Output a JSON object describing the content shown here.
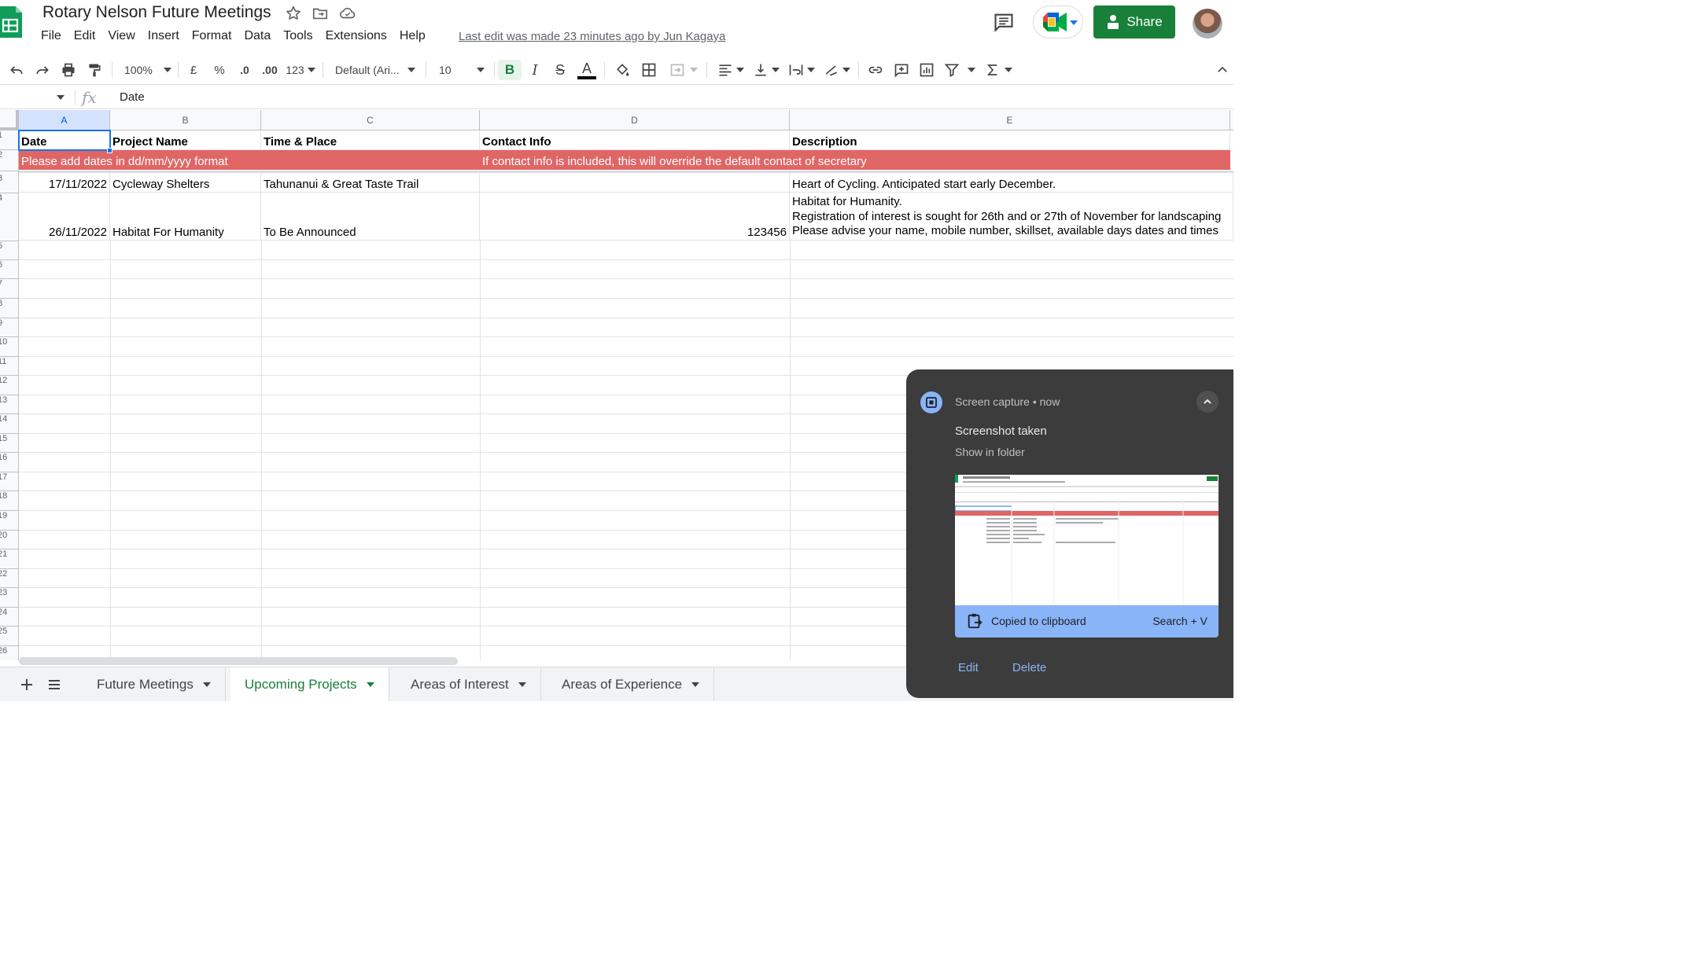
{
  "app": {
    "title": "Rotary Nelson Future Meetings",
    "last_edit": "Last edit was made 23 minutes ago by Jun Kagaya",
    "share_label": "Share"
  },
  "menu": [
    "File",
    "Edit",
    "View",
    "Insert",
    "Format",
    "Data",
    "Tools",
    "Extensions",
    "Help"
  ],
  "toolbar": {
    "zoom": "100%",
    "currency": "£",
    "percent": "%",
    "decrease_decimal": ".0",
    "increase_decimal": ".00",
    "more_formats": "123",
    "font": "Default (Ari...",
    "font_size": "10",
    "bold": "B",
    "italic": "I",
    "strike": "S",
    "text_color": "A"
  },
  "formula_bar": {
    "fx": "fx",
    "value": "Date"
  },
  "columns": [
    "A",
    "B",
    "C",
    "D",
    "E"
  ],
  "row_numbers": [
    "1",
    "2",
    "3",
    "4",
    "5",
    "6",
    "7",
    "8",
    "9",
    "10",
    "11",
    "12",
    "13",
    "14",
    "15",
    "16",
    "17",
    "18",
    "19",
    "20",
    "21",
    "22",
    "23",
    "24",
    "25",
    "26"
  ],
  "sheet": {
    "headers": [
      "Date",
      "Project Name",
      "Time & Place",
      "Contact Info",
      "Description"
    ],
    "note_left": "Please add dates in dd/mm/yyyy format",
    "note_right": "If contact info is included, this will override the default contact of secretary",
    "rows": [
      {
        "date": "17/11/2022",
        "project": "Cycleway Shelters",
        "place": "Tahunanui & Great Taste Trail",
        "contact": "",
        "description": "Heart of Cycling. Anticipated start early December."
      },
      {
        "date": "26/11/2022",
        "project": "Habitat For Humanity",
        "place": "To Be Announced",
        "contact": "123456",
        "description": "Habitat for Humanity.\nRegistration of interest is sought for 26th and or 27th of November for landscaping\nPlease advise your name, mobile number, skillset, available days dates and times"
      }
    ]
  },
  "tabs": [
    {
      "label": "Future Meetings",
      "active": false
    },
    {
      "label": "Upcoming Projects",
      "active": true
    },
    {
      "label": "Areas of Interest",
      "active": false
    },
    {
      "label": "Areas of Experience",
      "active": false
    }
  ],
  "notification": {
    "source": "Screen capture",
    "time": "now",
    "title": "Screenshot taken",
    "subtitle": "Show in folder",
    "clipboard_text": "Copied to clipboard",
    "shortcut": "Search + V",
    "edit_label": "Edit",
    "delete_label": "Delete"
  },
  "colors": {
    "accent": "#188038",
    "note_row": "#e06666",
    "selection": "#1a73e8",
    "notif_bg": "#3c3c3c",
    "notif_accent": "#8ab4f8"
  }
}
